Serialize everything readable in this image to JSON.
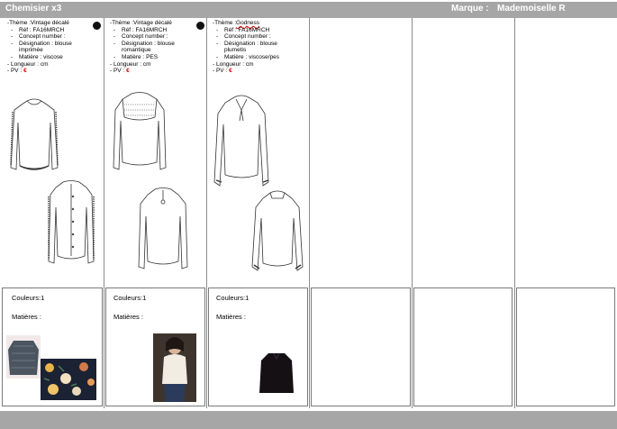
{
  "header": {
    "title": "Chemisier x3",
    "brand_label": "Marque :",
    "brand_value": "Mademoiselle R"
  },
  "products": [
    {
      "theme_prefix": "-Thème :",
      "theme": "Vintage décalé",
      "ref": "Réf : FA16MRCH",
      "concept": "Concept number :",
      "designation_1": "Désignation : blouse",
      "designation_2": "imprimée",
      "matiere": "Matière : viscose",
      "longueur": "- Longueur : cm",
      "pv_label": "- PV :",
      "pv_currency": "€",
      "couleurs": "Couleurs:1",
      "matieres": "Matières :"
    },
    {
      "theme_prefix": "-Thème :",
      "theme": "Vintage décalé",
      "ref": "Réf : FA16MRCH",
      "concept": "Concept number :",
      "designation_1": "Désignation : blouse",
      "designation_2": "romantique",
      "matiere": "Matière : PES",
      "longueur": "- Longueur : cm",
      "pv_label": "- PV :",
      "pv_currency": "€",
      "couleurs": "Couleurs:1",
      "matieres": "Matières :"
    },
    {
      "theme_prefix": "-Thème :",
      "theme": "Godness",
      "ref": "Réf : FA16MRCH",
      "concept": "Concept number :",
      "designation_1": "Désignation : blouse",
      "designation_2": "plumetis",
      "matiere": "Matière : viscose/pes",
      "longueur": "- Longueur : cm",
      "pv_label": "- PV :",
      "pv_currency": "€",
      "couleurs": "Couleurs:1",
      "matieres": "Matières :"
    }
  ],
  "bullet_glyph": "-",
  "colors": {
    "bar": "#a6a6a6",
    "price_accent": "#d00000",
    "grid_line": "#8c8c8c"
  }
}
